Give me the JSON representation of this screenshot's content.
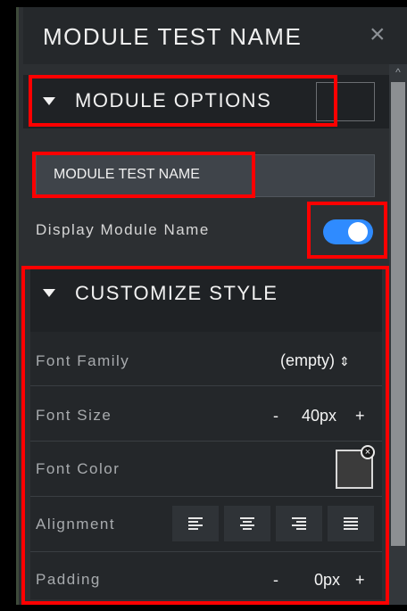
{
  "window": {
    "title": "MODULE TEST NAME",
    "close_glyph": "×"
  },
  "module_options": {
    "header": "MODULE OPTIONS",
    "name_value": "MODULE TEST NAME",
    "display_name_label": "Display Module Name",
    "display_name_enabled": true
  },
  "customize_style": {
    "header": "CUSTOMIZE STYLE",
    "font_family": {
      "label": "Font Family",
      "value": "(empty)"
    },
    "font_size": {
      "label": "Font Size",
      "minus": "-",
      "value": "40px",
      "plus": "+"
    },
    "font_color": {
      "label": "Font Color",
      "color": "#3b3b3b"
    },
    "alignment": {
      "label": "Alignment",
      "options": [
        "left",
        "center",
        "right",
        "justify"
      ],
      "icons": [
        "align-left-icon",
        "align-center-icon",
        "align-right-icon",
        "align-justify-icon"
      ]
    },
    "padding": {
      "label": "Padding",
      "minus": "-",
      "value": "0px",
      "plus": "+"
    }
  },
  "colors": {
    "toggle_on": "#2f8bff",
    "highlight": "#ff0000",
    "panel_bg": "#2c2f32"
  }
}
